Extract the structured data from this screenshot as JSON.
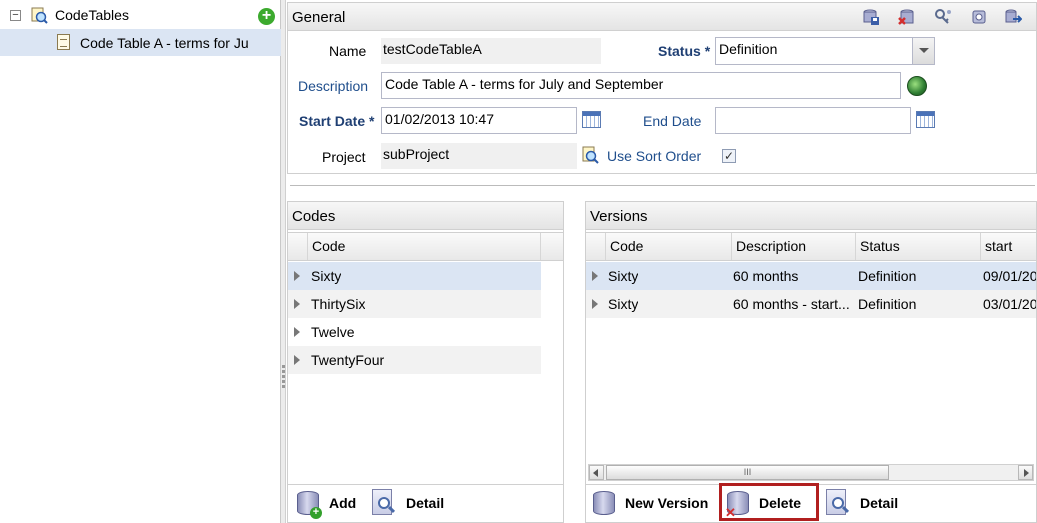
{
  "tree": {
    "root_label": "CodeTables",
    "child_label": "Code Table A - terms for Ju"
  },
  "general": {
    "title": "General",
    "name_label": "Name",
    "name_value": "testCodeTableA",
    "status_label": "Status",
    "status_value": "Definition",
    "description_label": "Description",
    "description_value": "Code Table A - terms for July and September",
    "start_date_label": "Start Date",
    "start_date_value": "01/02/2013 10:47",
    "end_date_label": "End Date",
    "end_date_value": "",
    "project_label": "Project",
    "project_value": "subProject",
    "use_sort_order_label": "Use Sort Order",
    "required_mark": "*",
    "toolbar_icons": [
      "save-icon",
      "delete-icon",
      "key-icon",
      "settings-icon",
      "export-icon"
    ]
  },
  "codes": {
    "title": "Codes",
    "column": "Code",
    "rows": [
      "Sixty",
      "ThirtySix",
      "Twelve",
      "TwentyFour"
    ],
    "add_label": "Add",
    "detail_label": "Detail"
  },
  "versions": {
    "title": "Versions",
    "columns": [
      "Code",
      "Description",
      "Status",
      "start"
    ],
    "rows": [
      {
        "code": "Sixty",
        "description": "60 months",
        "status": "Definition",
        "start": "09/01/20"
      },
      {
        "code": "Sixty",
        "description": "60 months - start...",
        "status": "Definition",
        "start": "03/01/20"
      }
    ],
    "scroll_grip": "III",
    "new_version_label": "New Version",
    "delete_label": "Delete",
    "detail_label": "Detail"
  },
  "colors": {
    "selection": "#dbe5f3",
    "label_blue": "#1f4e8c",
    "highlight_border": "#b11f1f"
  }
}
